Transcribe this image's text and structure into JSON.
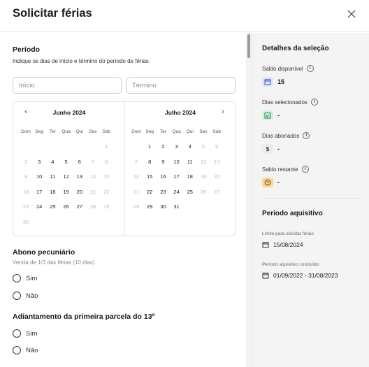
{
  "modal": {
    "title": "Solicitar férias"
  },
  "periodo": {
    "title": "Período",
    "subtitle": "Indique os dias de início e término do período de férias.",
    "start_placeholder": "Início",
    "end_placeholder": "Término"
  },
  "calendar": {
    "weekdays": [
      "Dom",
      "Seg",
      "Ter",
      "Qua",
      "Qui",
      "Sex",
      "Sáb"
    ],
    "months": [
      {
        "name": "Junho 2024",
        "weeks": [
          [
            "",
            "",
            "",
            "",
            "",
            "",
            "1"
          ],
          [
            "2",
            "3",
            "4",
            "5",
            "6",
            "7",
            "8"
          ],
          [
            "9",
            "10",
            "11",
            "12",
            "13",
            "14",
            "15"
          ],
          [
            "16",
            "17",
            "18",
            "19",
            "20",
            "21",
            "22"
          ],
          [
            "23",
            "24",
            "25",
            "26",
            "27",
            "28",
            "29"
          ],
          [
            "30",
            "",
            "",
            "",
            "",
            "",
            ""
          ]
        ],
        "selectable": [
          [
            0,
            0,
            0,
            0,
            0,
            0,
            0
          ],
          [
            0,
            1,
            1,
            1,
            1,
            0,
            0
          ],
          [
            0,
            1,
            1,
            1,
            1,
            0,
            0
          ],
          [
            0,
            1,
            1,
            1,
            1,
            0,
            0
          ],
          [
            0,
            1,
            1,
            1,
            1,
            0,
            0
          ],
          [
            0,
            0,
            0,
            0,
            0,
            0,
            0
          ]
        ]
      },
      {
        "name": "Julho 2024",
        "weeks": [
          [
            "",
            "1",
            "2",
            "3",
            "4",
            "5",
            "6"
          ],
          [
            "7",
            "8",
            "9",
            "10",
            "11",
            "12",
            "13"
          ],
          [
            "14",
            "15",
            "16",
            "17",
            "18",
            "19",
            "20"
          ],
          [
            "21",
            "22",
            "23",
            "24",
            "25",
            "26",
            "27"
          ],
          [
            "28",
            "29",
            "30",
            "31",
            "",
            "",
            ""
          ]
        ],
        "selectable": [
          [
            0,
            1,
            1,
            1,
            1,
            0,
            0
          ],
          [
            0,
            1,
            1,
            1,
            1,
            0,
            0
          ],
          [
            0,
            1,
            1,
            1,
            1,
            0,
            0
          ],
          [
            0,
            1,
            1,
            1,
            1,
            0,
            0
          ],
          [
            0,
            1,
            1,
            1,
            0,
            0,
            0
          ]
        ]
      }
    ]
  },
  "abono": {
    "title": "Abono pecuniário",
    "subtitle": "Venda de 1/3 das férias (10 dias)",
    "options": [
      "Sim",
      "Não"
    ]
  },
  "adiantamento": {
    "title": "Adiantamento da primeira parcela do 13º",
    "options": [
      "Sim",
      "Não"
    ]
  },
  "side": {
    "details_title": "Detalhes da seleção",
    "saldo_disponivel": {
      "label": "Saldo disponível",
      "value": "15",
      "icon": "calendar-icon",
      "color": "#dde6fb"
    },
    "dias_selecionados": {
      "label": "Dias selecionados",
      "value": "-",
      "icon": "check-calendar-icon",
      "color": "#d3f1e0"
    },
    "dias_abonados": {
      "label": "Dias abonados",
      "value": "-",
      "icon": "dollar-icon",
      "color": "#ececec"
    },
    "saldo_restante": {
      "label": "Saldo restante",
      "value": "-",
      "icon": "clock-icon",
      "color": "#fbd79a"
    },
    "aquisitivo_title": "Período aquisitivo",
    "limite_label": "Limite para solicitar férias",
    "limite_value": "15/08/2024",
    "concluido_label": "Período aquisitivo concluído",
    "concluido_value": "01/09/2022 - 31/08/2023"
  }
}
